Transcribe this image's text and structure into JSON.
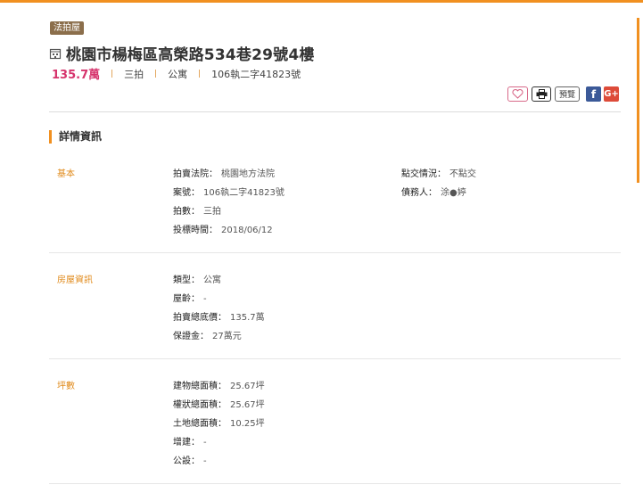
{
  "badge": "法拍屋",
  "title": "桃園市楊梅區高榮路534巷29號4樓",
  "price": "135.7萬",
  "round": "三拍",
  "category": "公寓",
  "case_no": "106執二字41823號",
  "actions": {
    "download": "預覽",
    "facebook": "f",
    "google": "G+"
  },
  "section_title": "詳情資訊",
  "colors": {
    "accent": "#f19020",
    "price": "#d6336c",
    "badge": "#8b6e4b",
    "facebook": "#3b5998",
    "google": "#dd4b39"
  },
  "basic": {
    "label": "基本",
    "court_k": "拍賣法院：",
    "court_v": "桃園地方法院",
    "case_k": "案號：",
    "case_v": "106執二字41823號",
    "round_k": "拍數：",
    "round_v": "三拍",
    "bid_k": "投標時間：",
    "bid_v": "2018/06/12",
    "handover_k": "點交情況：",
    "handover_v": "不點交",
    "debtor_k": "債務人：",
    "debtor_v": "涂●婷"
  },
  "house": {
    "label": "房屋資訊",
    "type_k": "類型：",
    "type_v": "公寓",
    "age_k": "屋齡：",
    "age_v": "-",
    "reserve_k": "拍賣總底價：",
    "reserve_v": "135.7萬",
    "deposit_k": "保證金：",
    "deposit_v": "27萬元"
  },
  "area": {
    "label": "坪數",
    "building_k": "建物總面積：",
    "building_v": "25.67坪",
    "title_k": "權狀總面積：",
    "title_v": "25.67坪",
    "land_k": "土地總面積：",
    "land_v": "10.25坪",
    "extra_k": "增建：",
    "extra_v": "-",
    "public_k": "公設：",
    "public_v": "-"
  }
}
